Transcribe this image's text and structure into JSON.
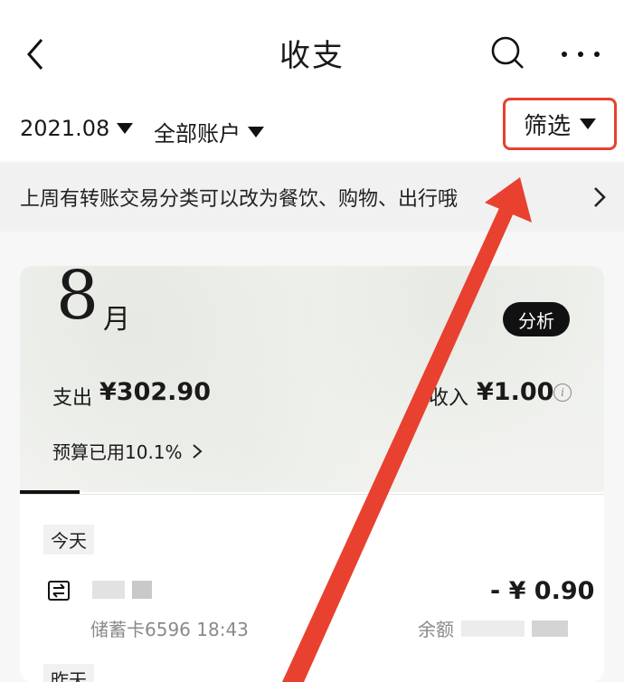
{
  "header": {
    "title": "收支",
    "back_icon": "chevron-left-icon",
    "search_icon": "search-icon",
    "more_icon": "more-horizontal-icon"
  },
  "filters": {
    "month": "2021.08",
    "account": "全部账户",
    "screen_label": "筛选",
    "dropdown_icon": "triangle-down-icon"
  },
  "notice": {
    "text": "上周有转账交易分类可以改为餐饮、购物、出行哦",
    "chevron_icon": "chevron-right-icon"
  },
  "summary": {
    "month_number": "8",
    "month_suffix": "月",
    "analyze_label": "分析",
    "expense_label": "支出",
    "expense_amount": "¥302.90",
    "income_label": "收入",
    "income_amount": "¥1.00",
    "info_icon": "info-icon",
    "budget_text": "预算已用10.1%",
    "budget_chevron_icon": "chevron-right-icon"
  },
  "transactions": {
    "today_label": "今天",
    "yesterday_label": "昨天",
    "items": [
      {
        "amount": "- ¥ 0.90",
        "card_time": "储蓄卡6596 18:43",
        "balance_label": "余额"
      }
    ]
  },
  "colors": {
    "highlight_border": "#e8412f",
    "arrow": "#e8412f"
  }
}
